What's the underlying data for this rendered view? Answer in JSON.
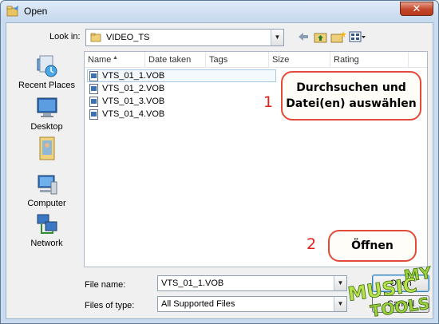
{
  "window": {
    "title": "Open",
    "close_glyph": "✕"
  },
  "lookin": {
    "label": "Look in:",
    "value": "VIDEO_TS"
  },
  "toolbar": {
    "icons": [
      "back-arrow-icon",
      "up-folder-icon",
      "new-folder-icon",
      "views-menu-icon"
    ]
  },
  "places": [
    {
      "label": "Recent Places",
      "icon": "recent-places-icon"
    },
    {
      "label": "Desktop",
      "icon": "desktop-icon"
    },
    {
      "label": "",
      "icon": "user-folder-icon"
    },
    {
      "label": "Computer",
      "icon": "computer-icon"
    },
    {
      "label": "Network",
      "icon": "network-icon"
    }
  ],
  "columns": [
    "Name",
    "Date taken",
    "Tags",
    "Size",
    "Rating"
  ],
  "files": [
    {
      "name": "VTS_01_1.VOB",
      "selected": true
    },
    {
      "name": "VTS_01_2.VOB",
      "selected": false
    },
    {
      "name": "VTS_01_3.VOB",
      "selected": false
    },
    {
      "name": "VTS_01_4.VOB",
      "selected": false
    }
  ],
  "annotations": {
    "step1_number": "1",
    "step1_line1": "Durchsuchen und",
    "step1_line2": "Datei(en) auswählen",
    "step2_number": "2",
    "step2_text": "Öffnen"
  },
  "filename": {
    "label": "File name:",
    "value": "VTS_01_1.VOB"
  },
  "filetype": {
    "label": "Files of type:",
    "value": "All Supported Files"
  },
  "buttons": {
    "open": "Open",
    "cancel": "Cancel"
  },
  "logo": {
    "line1": "MY",
    "line2": "MUSIC",
    "line3": "TOOLS"
  },
  "colors": {
    "accent_red": "#e0201b",
    "window_frame": "#c9dcef",
    "selection": "#a8c8e8"
  }
}
